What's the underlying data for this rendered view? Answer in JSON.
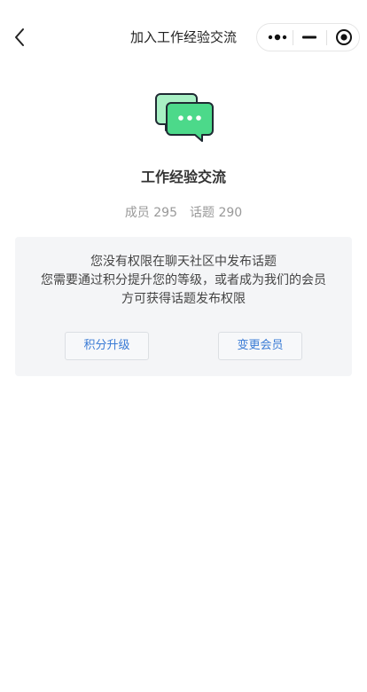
{
  "navbar": {
    "title": "加入工作经验交流",
    "back_icon": "back-arrow-icon",
    "capsule": {
      "more_icon": "more-dots-icon",
      "minimize_icon": "minimize-icon",
      "close_icon": "target-close-icon"
    }
  },
  "group": {
    "icon": "chat-bubbles-icon",
    "name": "工作经验交流",
    "members_label": "成员",
    "members_count": "295",
    "topics_label": "话题",
    "topics_count": "290"
  },
  "notice": {
    "lines": [
      "您没有权限在聊天社区中发布话题",
      "您需要通过积分提升您的等级，或者成为我们的会员",
      "方可获得话题发布权限"
    ],
    "upgrade_button": "积分升级",
    "member_button": "变更会员"
  },
  "colors": {
    "accent": "#3a7bd5",
    "icon_green": "#4cd98a",
    "card_bg": "#f4f5f7"
  }
}
